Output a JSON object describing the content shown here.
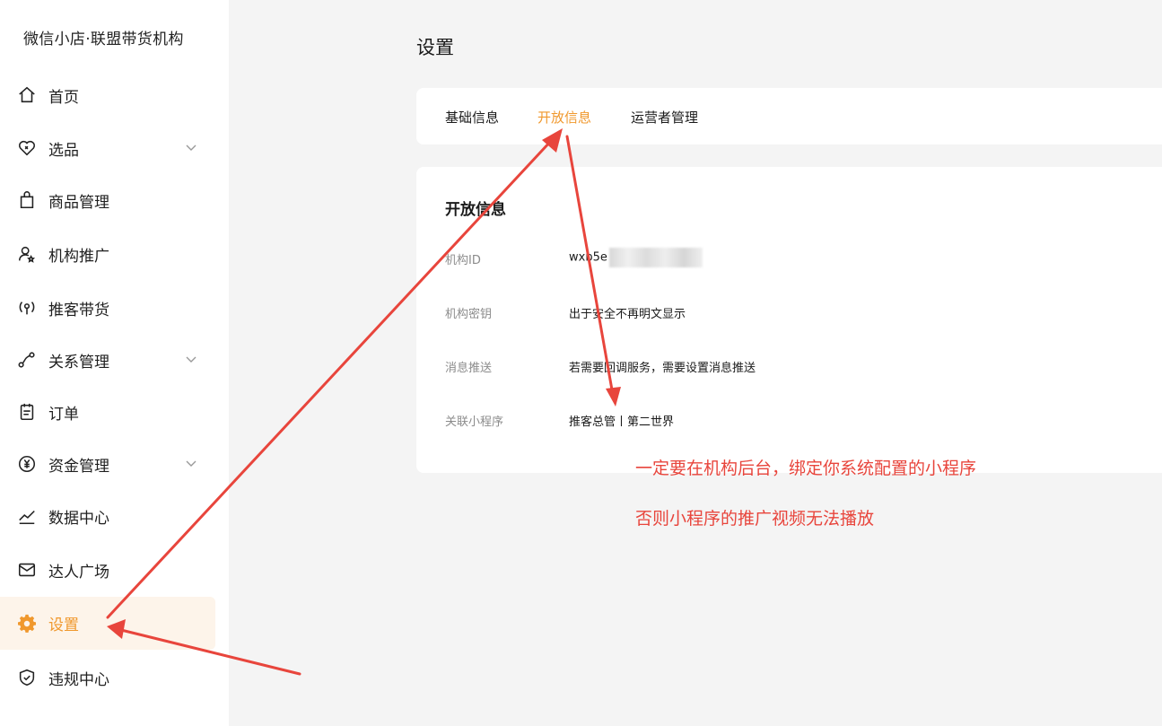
{
  "sidebar": {
    "brand": "微信小店·联盟带货机构",
    "items": [
      {
        "label": "首页",
        "icon": "home-icon"
      },
      {
        "label": "选品",
        "icon": "heart-tag-icon",
        "expandable": true
      },
      {
        "label": "商品管理",
        "icon": "shopping-bag-icon"
      },
      {
        "label": "机构推广",
        "icon": "user-star-icon"
      },
      {
        "label": "推客带货",
        "icon": "broadcast-icon"
      },
      {
        "label": "关系管理",
        "icon": "relation-icon",
        "expandable": true
      },
      {
        "label": "订单",
        "icon": "clipboard-icon"
      },
      {
        "label": "资金管理",
        "icon": "yen-icon",
        "expandable": true
      },
      {
        "label": "数据中心",
        "icon": "trend-chart-icon"
      },
      {
        "label": "达人广场",
        "icon": "envelope-icon"
      },
      {
        "label": "设置",
        "icon": "gear-icon",
        "active": true
      },
      {
        "label": "违规中心",
        "icon": "shield-icon"
      }
    ]
  },
  "main": {
    "title": "设置",
    "tabs": [
      {
        "label": "基础信息"
      },
      {
        "label": "开放信息",
        "active": true
      },
      {
        "label": "运营者管理"
      }
    ],
    "section_title": "开放信息",
    "rows": [
      {
        "label": "机构ID",
        "value": "wxb5e"
      },
      {
        "label": "机构密钥",
        "value": "出于安全不再明文显示"
      },
      {
        "label": "消息推送",
        "value": "若需要回调服务，需要设置消息推送"
      },
      {
        "label": "关联小程序",
        "value": "推客总管丨第二世界"
      }
    ]
  },
  "annotations": [
    "一定要在机构后台，绑定你系统配置的小程序",
    "否则小程序的推广视频无法播放"
  ],
  "colors": {
    "accent": "#f0982d",
    "annotation": "#e8453c",
    "active_bg": "#fdf4ea"
  }
}
